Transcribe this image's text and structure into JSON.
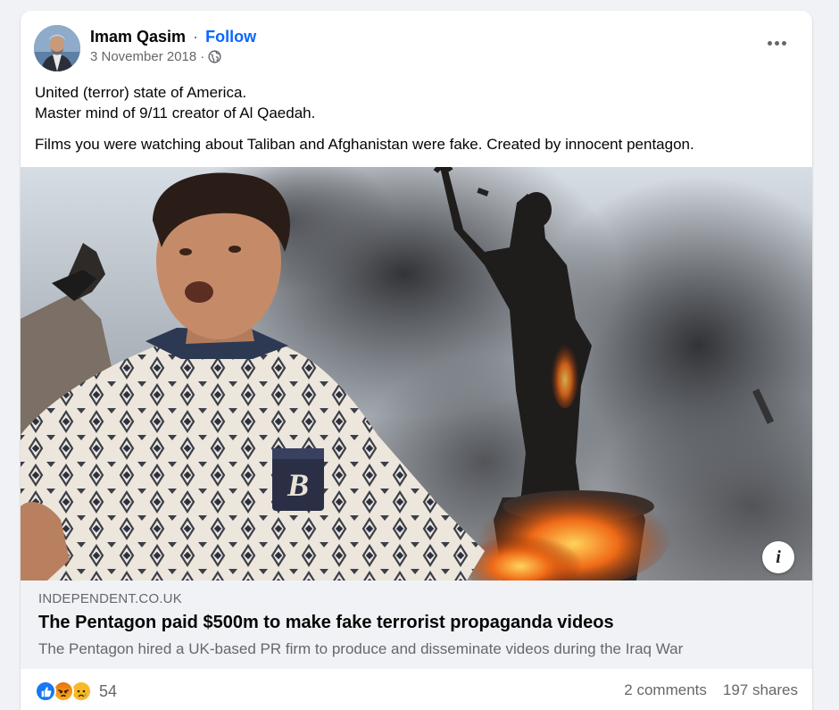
{
  "post": {
    "author": "Imam Qasim",
    "separator": "·",
    "follow_label": "Follow",
    "date": "3 November 2018",
    "date_separator": "·",
    "privacy_icon": "globe-icon",
    "more_icon": "more-options-icon",
    "text_lines": [
      "United (terror) state of America.",
      "Master mind of 9/11 creator of Al Qaedah.",
      "Films you were watching about Taliban and Afghanistan were fake. Created by innocent pentagon."
    ],
    "image": {
      "info_label": "i",
      "badge_text": "B"
    },
    "link": {
      "domain": "INDEPENDENT.CO.UK",
      "title": "The Pentagon paid $500m to make fake terrorist propaganda videos",
      "description": "The Pentagon hired a UK-based PR firm to produce and disseminate videos during the Iraq War"
    },
    "reactions": {
      "icons": [
        "like-icon",
        "angry-icon",
        "sad-icon"
      ],
      "count": "54"
    },
    "comments": "2 comments",
    "shares": "197 shares"
  },
  "colors": {
    "accent": "#0866ff",
    "like": "#1877f2",
    "secondary_text": "#65676b",
    "link_bg": "#f0f2f5"
  }
}
